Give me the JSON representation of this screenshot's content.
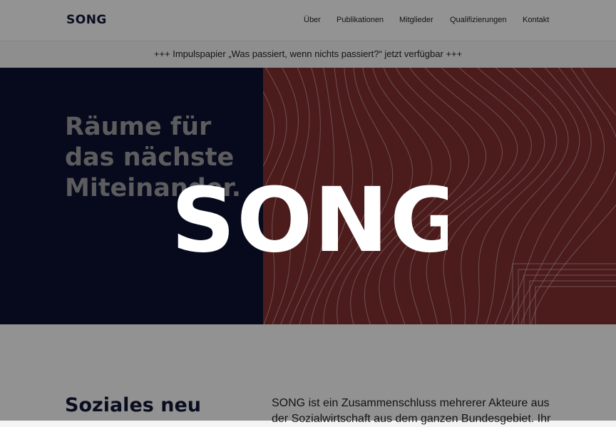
{
  "header": {
    "logo": "SONG",
    "nav": [
      {
        "label": "Über"
      },
      {
        "label": "Publikationen"
      },
      {
        "label": "Mitglieder"
      },
      {
        "label": "Qualifizierungen"
      },
      {
        "label": "Kontakt"
      }
    ]
  },
  "announcement": {
    "text": "+++ Impulspapier „Was passiert, wenn nichts passiert?“ jetzt verfügbar +++"
  },
  "hero": {
    "headline_lines": [
      "Räume für",
      "das nächste",
      "Miteinander."
    ]
  },
  "overlay": {
    "logo_text": "SONG"
  },
  "intro": {
    "heading": "Soziales neu",
    "text": "SONG ist ein Zusammenschluss mehrerer Akteure aus der Sozialwirtschaft aus dem ganzen Bundesgebiet. Ihr"
  },
  "colors": {
    "navy": "#0c1230",
    "red": "#7d2f2e",
    "page_bg": "#f4f4f4"
  }
}
